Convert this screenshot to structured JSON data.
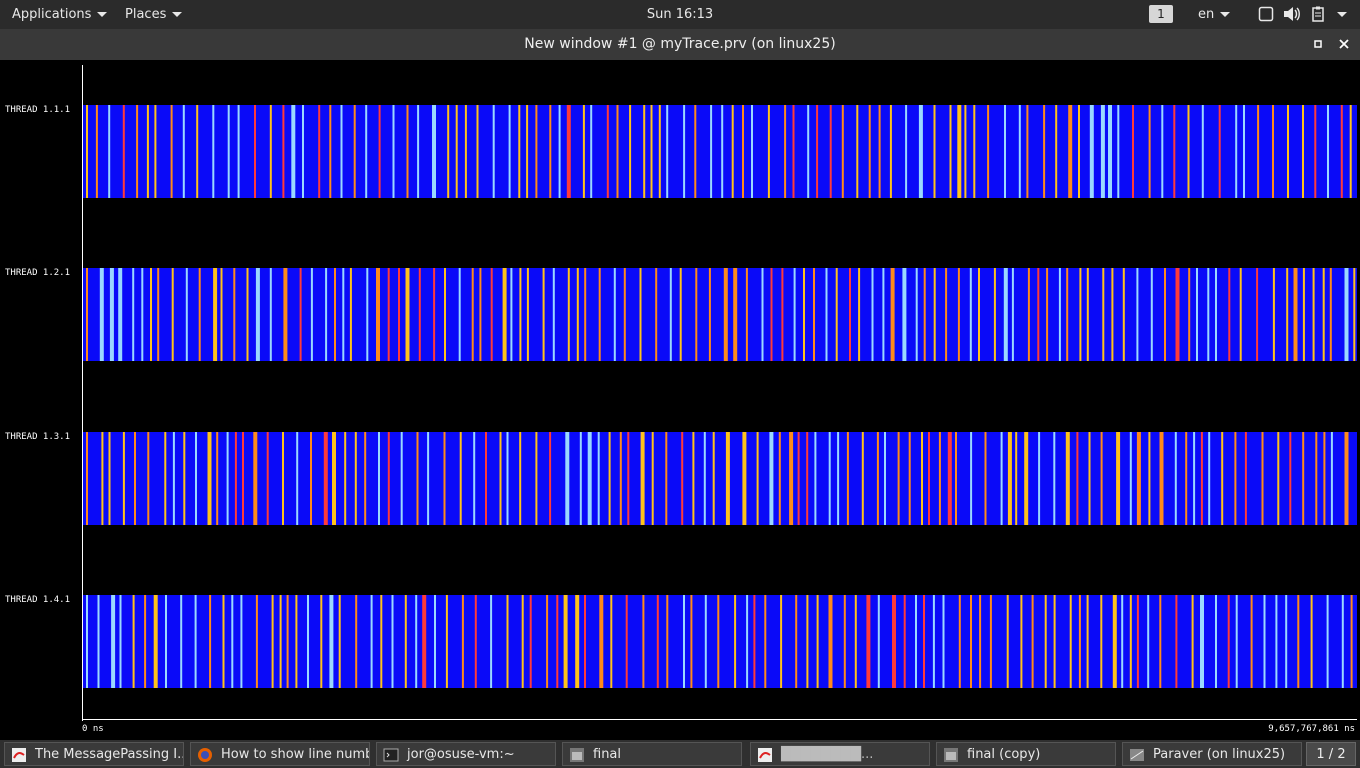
{
  "topbar": {
    "applications": "Applications",
    "places": "Places",
    "clock": "Sun 16:13",
    "workspace": "1",
    "language": "en"
  },
  "window": {
    "title": "New window #1 @ myTrace.prv (on linux25)"
  },
  "timeline": {
    "threads": [
      "THREAD 1.1.1",
      "THREAD 1.2.1",
      "THREAD 1.3.1",
      "THREAD 1.4.1"
    ],
    "x_start_label": "0 ns",
    "x_end_label": "9,657,767,861 ns",
    "colors": {
      "running": "#0a0af8",
      "orange": "#ff8a1a",
      "red": "#ff3a3a",
      "yellow": "#ffc21a",
      "cyan": "#9ad8ff",
      "white": "#ffffff"
    }
  },
  "taskbar": {
    "items": [
      "The MessagePassing I...",
      "How to show line numb...",
      "jor@osuse-vm:~",
      "final",
      "████████...",
      "final (copy)",
      "Paraver (on linux25)"
    ],
    "pager": "1 / 2"
  }
}
